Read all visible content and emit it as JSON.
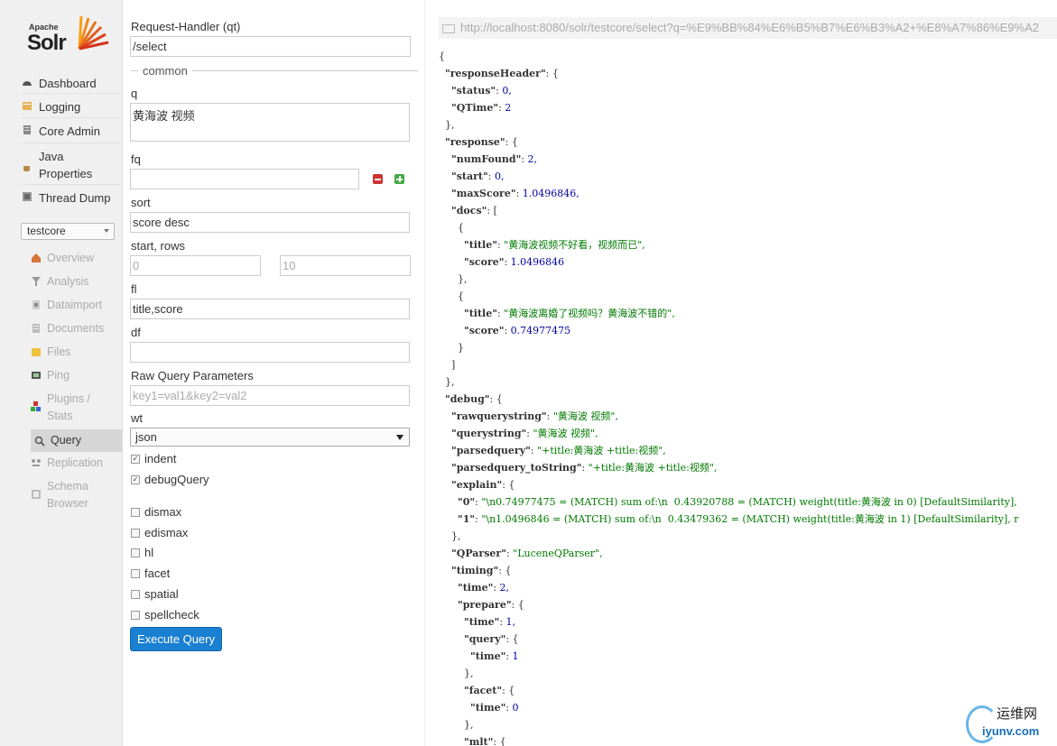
{
  "logo": {
    "apache": "Apache",
    "solr": "Solr"
  },
  "sidebar": {
    "items": [
      {
        "label": "Dashboard",
        "icon": "dashboard-icon"
      },
      {
        "label": "Logging",
        "icon": "logging-icon"
      },
      {
        "label": "Core Admin",
        "icon": "core-admin-icon"
      },
      {
        "label": "Java Properties",
        "icon": "java-properties-icon"
      },
      {
        "label": "Thread Dump",
        "icon": "thread-dump-icon"
      }
    ],
    "core_selected": "testcore",
    "core_items": [
      {
        "label": "Overview",
        "icon": "overview-icon"
      },
      {
        "label": "Analysis",
        "icon": "analysis-icon"
      },
      {
        "label": "Dataimport",
        "icon": "dataimport-icon"
      },
      {
        "label": "Documents",
        "icon": "documents-icon"
      },
      {
        "label": "Files",
        "icon": "files-icon"
      },
      {
        "label": "Ping",
        "icon": "ping-icon"
      },
      {
        "label": "Plugins / Stats",
        "icon": "plugins-icon"
      },
      {
        "label": "Query",
        "icon": "query-icon",
        "active": true
      },
      {
        "label": "Replication",
        "icon": "replication-icon"
      },
      {
        "label": "Schema Browser",
        "icon": "schema-browser-icon"
      }
    ]
  },
  "form": {
    "qt_label": "Request-Handler (qt)",
    "qt_value": "/select",
    "common_legend": "common",
    "q_label": "q",
    "q_value": "黄海波 视频",
    "fq_label": "fq",
    "fq_value": "",
    "sort_label": "sort",
    "sort_value": "score desc",
    "start_rows_label": "start, rows",
    "start_value": "0",
    "rows_value": "10",
    "fl_label": "fl",
    "fl_value": "title,score",
    "df_label": "df",
    "df_value": "",
    "raw_label": "Raw Query Parameters",
    "raw_placeholder": "key1=val1&key2=val2",
    "wt_label": "wt",
    "wt_value": "json",
    "indent_label": "indent",
    "indent_checked": true,
    "debug_label": "debugQuery",
    "debug_checked": true,
    "dismax_label": "dismax",
    "edismax_label": "edismax",
    "hl_label": "hl",
    "facet_label": "facet",
    "spatial_label": "spatial",
    "spellcheck_label": "spellcheck",
    "execute_label": "Execute Query"
  },
  "response": {
    "url": "http://localhost:8080/solr/testcore/select?q=%E9%BB%84%E6%B5%B7%E6%B3%A2+%E8%A7%86%E9%A2",
    "json_lines": [
      "{",
      "  \"responseHeader\": {",
      "    \"status\": 0,",
      "    \"QTime\": 2",
      "  },",
      "  \"response\": {",
      "    \"numFound\": 2,",
      "    \"start\": 0,",
      "    \"maxScore\": 1.0496846,",
      "    \"docs\": [",
      "      {",
      "        \"title\": \"黄海波视频不好看，视频而已\",",
      "        \"score\": 1.0496846",
      "      },",
      "      {",
      "        \"title\": \"黄海波离婚了视频吗？黄海波不错的\",",
      "        \"score\": 0.74977475",
      "      }",
      "    ]",
      "  },",
      "  \"debug\": {",
      "    \"rawquerystring\": \"黄海波 视频\",",
      "    \"querystring\": \"黄海波 视频\",",
      "    \"parsedquery\": \"+title:黄海波 +title:视频\",",
      "    \"parsedquery_toString\": \"+title:黄海波 +title:视频\",",
      "    \"explain\": {",
      "      \"0\": \"\\n0.74977475 = (MATCH) sum of:\\n  0.43920788 = (MATCH) weight(title:黄海波 in 0) [DefaultSimilarity],",
      "      \"1\": \"\\n1.0496846 = (MATCH) sum of:\\n  0.43479362 = (MATCH) weight(title:黄海波 in 1) [DefaultSimilarity], r",
      "    },",
      "    \"QParser\": \"LuceneQParser\",",
      "    \"timing\": {",
      "      \"time\": 2,",
      "      \"prepare\": {",
      "        \"time\": 1,",
      "        \"query\": {",
      "          \"time\": 1",
      "        },",
      "        \"facet\": {",
      "          \"time\": 0",
      "        },",
      "        \"mlt\": {"
    ]
  },
  "watermark": {
    "line1": "运维网",
    "line2": "iyunv.com"
  }
}
